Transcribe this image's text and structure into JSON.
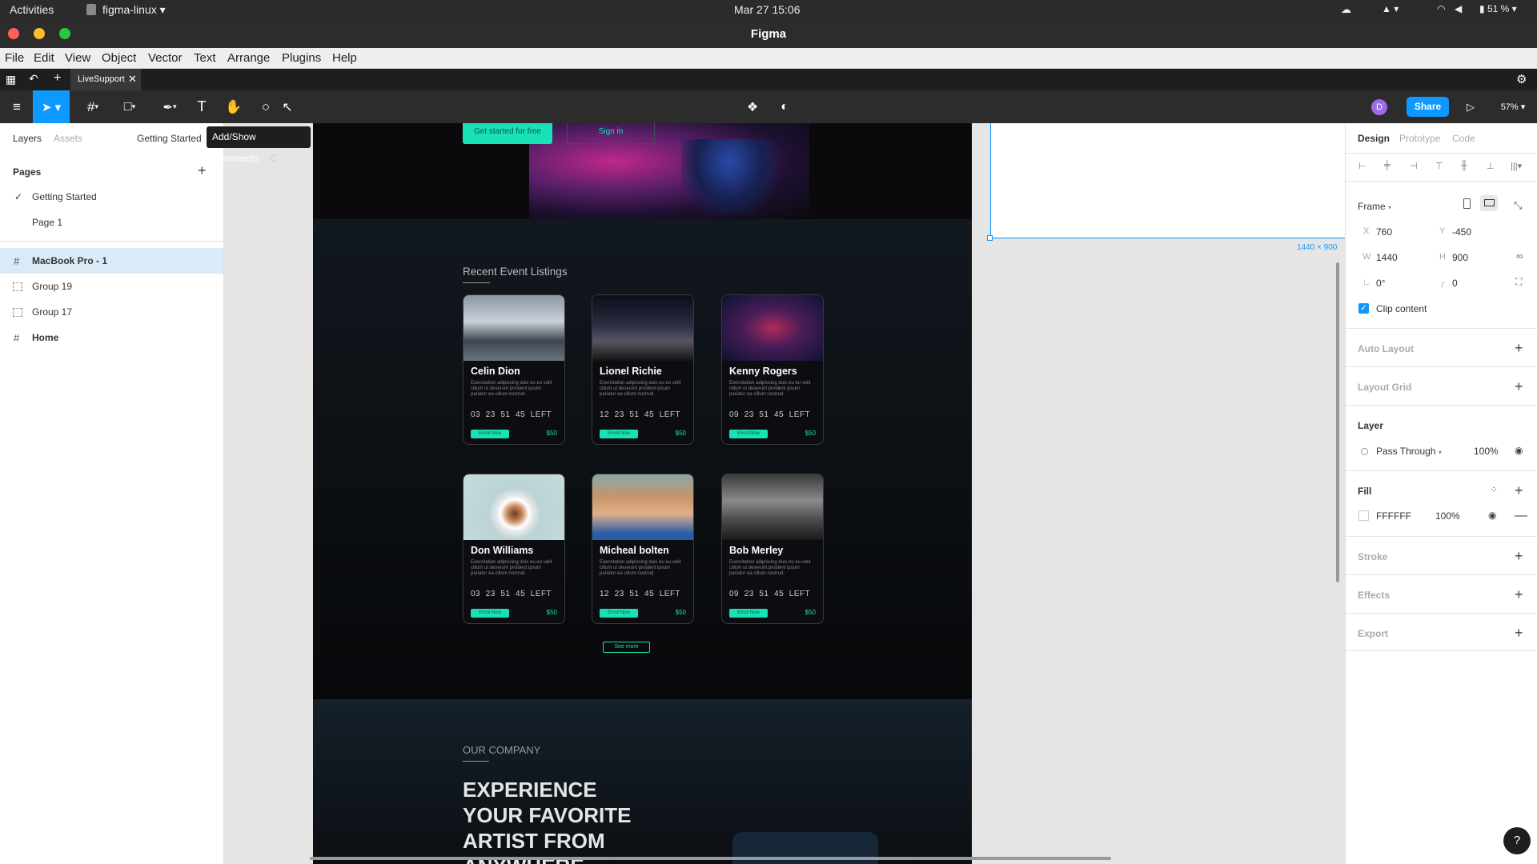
{
  "system_bar": {
    "activities": "Activities",
    "app_menu": "figma-linux",
    "datetime": "Mar 27  15:06",
    "battery": "51 %"
  },
  "window": {
    "title": "Figma"
  },
  "menu": [
    "File",
    "Edit",
    "View",
    "Object",
    "Vector",
    "Text",
    "Arrange",
    "Plugins",
    "Help"
  ],
  "tab": {
    "label": "LiveSupport"
  },
  "toolbar": {
    "share": "Share",
    "zoom": "57%",
    "avatar": "D"
  },
  "left_panel": {
    "tabs": {
      "layers": "Layers",
      "assets": "Assets",
      "page_switch": "Getting Started"
    },
    "tooltip": "Add/Show Comments",
    "tooltip_cut": "C",
    "pages_title": "Pages",
    "pages": [
      "Getting Started",
      "Page 1"
    ],
    "layers": [
      "MacBook Pro - 1",
      "Group 19",
      "Group 17",
      "Home"
    ]
  },
  "canvas": {
    "hero": {
      "cta_primary": "Get started for free",
      "cta_secondary": "Sign in"
    },
    "events_title": "Recent Event Listings",
    "cards": [
      {
        "name": "Celin Dion",
        "countdown": "03  23  51  45  LEFT",
        "price": "$50"
      },
      {
        "name": "Lionel Richie",
        "countdown": "12  23  51  45  LEFT",
        "price": "$50"
      },
      {
        "name": "Kenny Rogers",
        "countdown": "09  23  51  45  LEFT",
        "price": "$50"
      },
      {
        "name": "Don Williams",
        "countdown": "03  23  51  45  LEFT",
        "price": "$50"
      },
      {
        "name": "Micheal bolten",
        "countdown": "12  23  51  45  LEFT",
        "price": "$50"
      },
      {
        "name": "Bob Merley",
        "countdown": "09  23  51  45  LEFT",
        "price": "$50"
      }
    ],
    "card_desc": "Exercitation adipiscing duis eu eu velit cillum ut deserunt proident ipsum pariatur ea cillum nostrud.",
    "enrol": "Enrol Now",
    "see_more": "See more",
    "company_label": "OUR COMPANY",
    "company_heading": [
      "EXPERIENCE",
      "YOUR FAVORITE",
      "ARTIST FROM",
      "ANYWHERE"
    ],
    "frame_size_label": "1440 × 900"
  },
  "right_panel": {
    "tabs": {
      "design": "Design",
      "prototype": "Prototype",
      "code": "Code"
    },
    "frame_label": "Frame",
    "x_label": "X",
    "x": "760",
    "y_label": "Y",
    "y": "-450",
    "w_label": "W",
    "w": "1440",
    "h_label": "H",
    "h": "900",
    "rotation": "0°",
    "radius": "0",
    "clip_content": "Clip content",
    "auto_layout": "Auto Layout",
    "layout_grid": "Layout Grid",
    "layer_title": "Layer",
    "blend": "Pass Through",
    "opacity": "100%",
    "fill_title": "Fill",
    "fill_hex": "FFFFFF",
    "fill_opacity": "100%",
    "stroke": "Stroke",
    "effects": "Effects",
    "export": "Export",
    "help": "?"
  },
  "colors": {
    "accent": "#0d99ff",
    "teal": "#18e1b5"
  }
}
